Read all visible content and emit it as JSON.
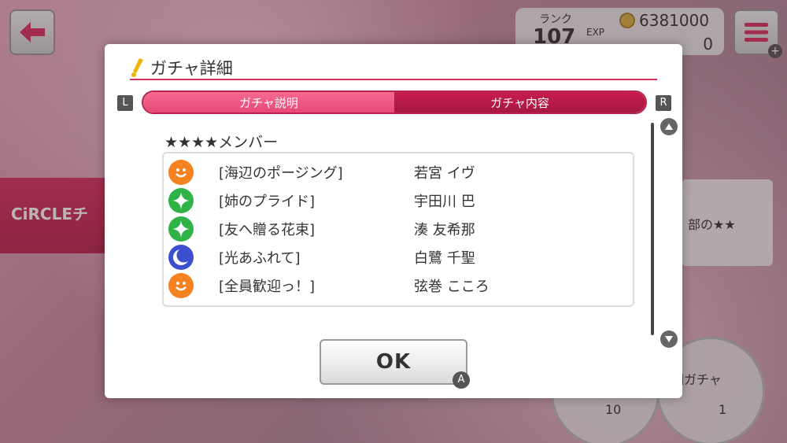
{
  "background": {
    "rank_label": "ランク",
    "rank_value": "107",
    "exp_label": "EXP",
    "coins": "6381000",
    "tickets": "0",
    "banner_text": "CiRCLEチ",
    "panel_text": "部の★★",
    "roll_button_label": "回ガチャ",
    "roll_count_left": "10",
    "roll_count_right": "1"
  },
  "dialog": {
    "title": "ガチャ詳細",
    "tab_left_key": "L",
    "tab_right_key": "R",
    "tabs": [
      {
        "label": "ガチャ説明",
        "selected": false
      },
      {
        "label": "ガチャ内容",
        "selected": true
      }
    ],
    "section_title": "★★★★メンバー",
    "members": [
      {
        "attribute": "happy",
        "card": "[海辺のポージング]",
        "character": "若宮 イヴ"
      },
      {
        "attribute": "pure",
        "card": "[姉のプライド]",
        "character": "宇田川 巴"
      },
      {
        "attribute": "pure",
        "card": "[友へ贈る花束]",
        "character": "湊 友希那"
      },
      {
        "attribute": "cool",
        "card": "[光あふれて]",
        "character": "白鷺 千聖"
      },
      {
        "attribute": "happy",
        "card": "[全員歓迎っ！]",
        "character": "弦巻 こころ"
      }
    ],
    "ok_label": "OK",
    "ok_key": "A"
  },
  "colors": {
    "accent": "#d8325e",
    "happy": "#f58220",
    "pure": "#2fb347",
    "cool": "#3b4fd0"
  }
}
